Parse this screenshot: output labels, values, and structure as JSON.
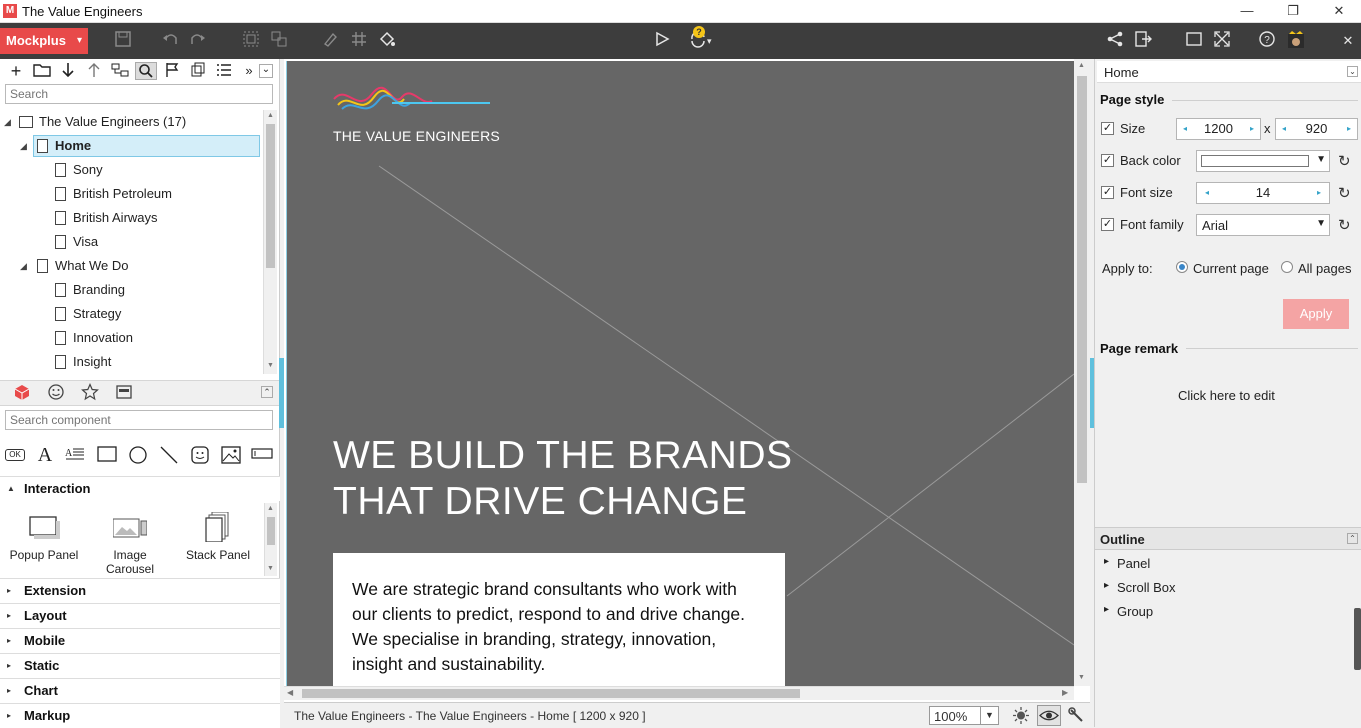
{
  "window": {
    "title": "The Value Engineers",
    "logo_letter": "M",
    "minimize": "—",
    "maximize": "❐",
    "close": "✕"
  },
  "toolbar": {
    "brand_label": "Mockplus",
    "brand_arrow": "▾",
    "badge": "?",
    "panel_close": "✕"
  },
  "project_panel": {
    "search_placeholder": "Search",
    "more_glyph": "»",
    "collapse_glyph": "⌄",
    "tree": [
      {
        "label": "The Value Engineers (17)",
        "level": 0,
        "expand": "◢",
        "type": "project"
      },
      {
        "label": "Home",
        "level": 1,
        "expand": "◢",
        "type": "page",
        "selected": true
      },
      {
        "label": "Sony",
        "level": 2,
        "type": "page"
      },
      {
        "label": "British Petroleum",
        "level": 2,
        "type": "page"
      },
      {
        "label": "British Airways",
        "level": 2,
        "type": "page"
      },
      {
        "label": "Visa",
        "level": 2,
        "type": "page"
      },
      {
        "label": "What We Do",
        "level": 1,
        "expand": "◢",
        "type": "page"
      },
      {
        "label": "Branding",
        "level": 2,
        "type": "page"
      },
      {
        "label": "Strategy",
        "level": 2,
        "type": "page"
      },
      {
        "label": "Innovation",
        "level": 2,
        "type": "page"
      },
      {
        "label": "Insight",
        "level": 2,
        "type": "page"
      }
    ]
  },
  "component_panel": {
    "search_placeholder": "Search component",
    "ok_label": "OK",
    "text_glyph": "A",
    "interaction_title": "Interaction",
    "items": [
      {
        "label": "Popup Panel"
      },
      {
        "label": "Image Carousel"
      },
      {
        "label": "Stack Panel"
      }
    ],
    "categories": [
      "Extension",
      "Layout",
      "Mobile",
      "Static",
      "Chart",
      "Markup"
    ]
  },
  "canvas": {
    "logo_text": "THE VALUE ENGINEERS",
    "headline_line1": "WE BUILD THE BRANDS",
    "headline_line2": "THAT DRIVE CHANGE",
    "body_line1": "We are strategic brand consultants who work with",
    "body_line2": "our clients to predict, respond to and drive change.",
    "body_line3": "We specialise in branding, strategy, innovation,",
    "body_line4": "insight and sustainability.",
    "colors": {
      "background": "#666666",
      "text": "#ffffff",
      "accent": "#34a3c9"
    }
  },
  "statusbar": {
    "path": "The Value Engineers - The Value Engineers - Home [ 1200 x 920 ]",
    "zoom": "100%"
  },
  "properties": {
    "page_name": "Home",
    "page_style_title": "Page style",
    "size_label": "Size",
    "width": "1200",
    "height": "920",
    "times": "x",
    "back_color_label": "Back color",
    "font_size_label": "Font size",
    "font_size": "14",
    "font_family_label": "Font family",
    "font_family": "Arial",
    "apply_to_label": "Apply to:",
    "current_page": "Current page",
    "all_pages": "All pages",
    "apply_button": "Apply",
    "page_remark_title": "Page remark",
    "remark_placeholder": "Click here to edit",
    "checkmark": "✓",
    "reset_glyph": "↻",
    "dropdown_glyph": "▼",
    "left_arrow": "◂",
    "right_arrow": "▸"
  },
  "outline": {
    "title": "Outline",
    "items": [
      "Panel",
      "Scroll Box",
      "Group"
    ]
  }
}
